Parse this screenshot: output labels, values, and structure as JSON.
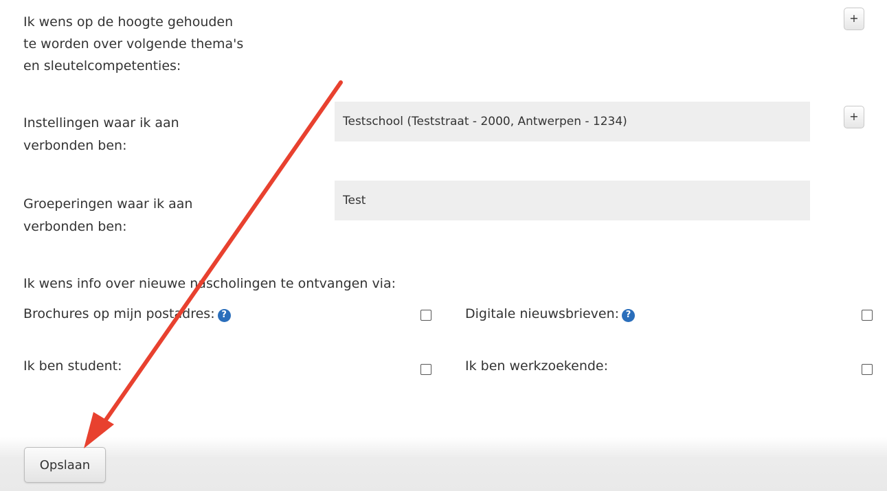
{
  "themes": {
    "label_line1": "Ik wens op de hoogte gehouden",
    "label_line2": "te worden over volgende thema's",
    "label_line3": "en sleutelcompetenties:",
    "add_label": "+"
  },
  "institutions": {
    "label_line1": "Instellingen waar ik aan",
    "label_line2": "verbonden ben:",
    "value": "Testschool (Teststraat - 2000, Antwerpen - 1234)",
    "add_label": "+"
  },
  "groupings": {
    "label_line1": "Groeperingen waar ik aan",
    "label_line2": "verbonden ben:",
    "value": "Test"
  },
  "newsletter": {
    "intro": "Ik wens info over nieuwe nascholingen te ontvangen via:",
    "brochures_label": "Brochures op mijn postadres:",
    "digital_label": "Digitale nieuwsbrieven:",
    "help_glyph": "?",
    "brochures_checked": false,
    "digital_checked": false
  },
  "status": {
    "student_label": "Ik ben student:",
    "jobseeker_label": "Ik ben werkzoekende:",
    "student_checked": false,
    "jobseeker_checked": false
  },
  "footer": {
    "save_label": "Opslaan"
  },
  "annotation": {
    "arrow_color": "#e8412f",
    "arrow_target": "save-button"
  },
  "colors": {
    "help_icon": "#2a6ebb",
    "field_background": "#eeeeee",
    "text": "#333333"
  }
}
